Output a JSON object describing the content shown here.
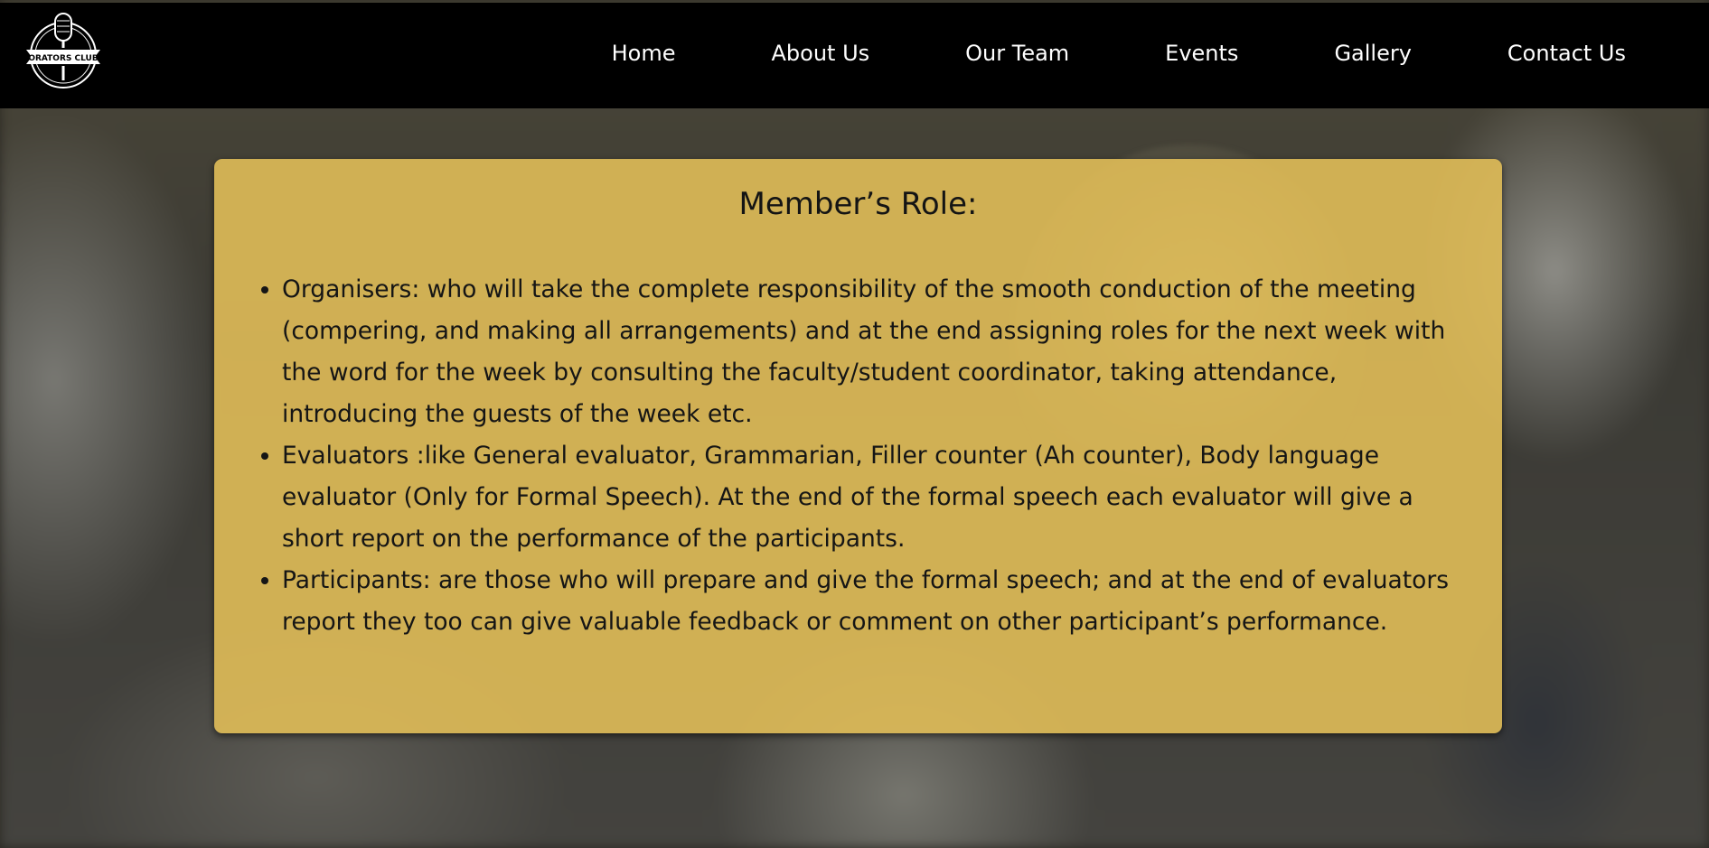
{
  "nav": {
    "logo_text": "ORATORS CLUB",
    "items": [
      {
        "label": "Home"
      },
      {
        "label": "About Us"
      },
      {
        "label": "Our Team"
      },
      {
        "label": "Events"
      },
      {
        "label": "Gallery"
      },
      {
        "label": "Contact Us"
      }
    ]
  },
  "content": {
    "title": "Member’s Role:",
    "roles": [
      "Organisers: who will take the complete responsibility of the smooth conduction of the meeting (compering, and making all arrangements) and at the end assigning roles for the next week with the word for the week by consulting the faculty/student coordinator, taking attendance, introducing the guests of the week etc.",
      "Evaluators :like General evaluator, Grammarian, Filler counter (Ah counter), Body language evaluator (Only for Formal Speech). At the end of the formal speech each evaluator will give a short report on the performance of the participants.",
      "Participants: are those who will prepare and give the formal speech; and at the end of evaluators report they too can give valuable feedback or comment on other participant’s performance."
    ]
  },
  "colors": {
    "navbar_bg": "#000000",
    "nav_text": "#ffffff",
    "card_bg": "#e0bc58",
    "text": "#141414"
  }
}
